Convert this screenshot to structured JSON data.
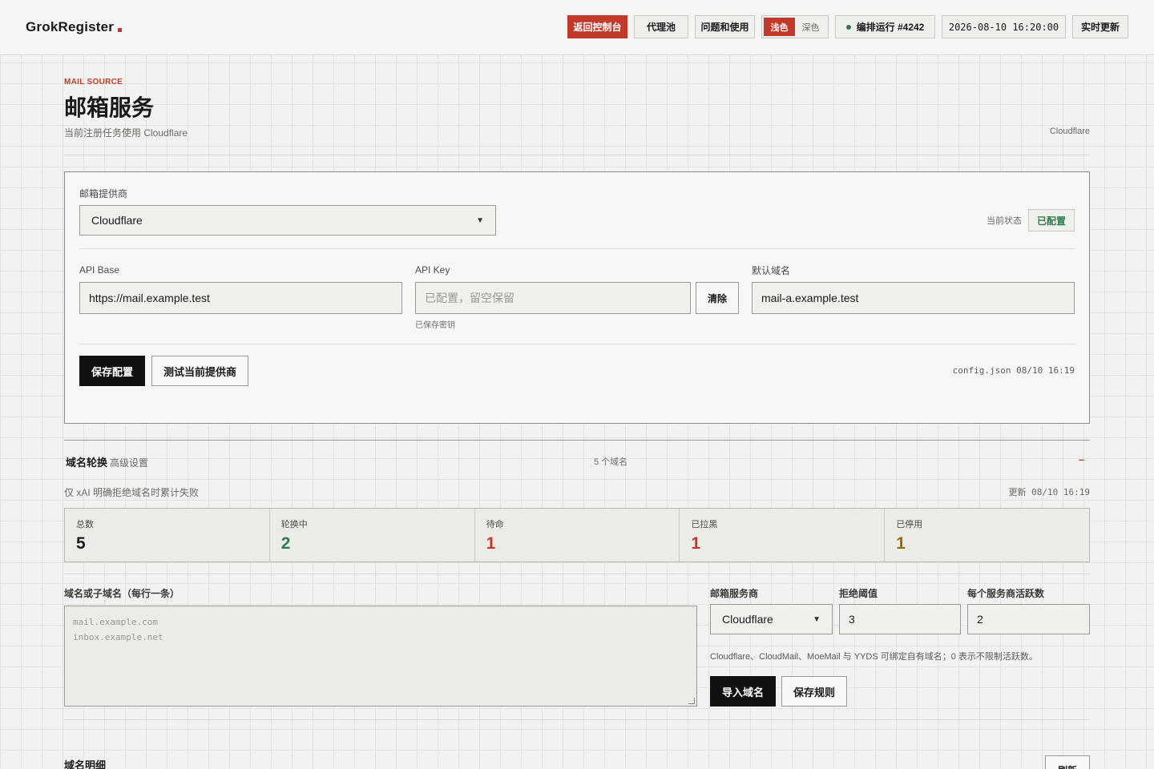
{
  "topbar": {
    "brand": "GrokRegister",
    "buttons": {
      "back_console": "返回控制台",
      "proxy_pool": "代理池",
      "faq_usage": "问题和使用",
      "realtime_refresh": "实时更新"
    },
    "theme": {
      "light": "浅色",
      "dark": "深色",
      "active": "light"
    },
    "run_status": "编排运行 #4242",
    "datetime": "2026-08-10 16:20:00"
  },
  "header": {
    "eyebrow": "MAIL SOURCE",
    "title": "邮箱服务",
    "subtitle": "当前注册任务使用 Cloudflare",
    "right_label": "Cloudflare"
  },
  "provider_card": {
    "provider_label": "邮箱提供商",
    "provider_value": "Cloudflare",
    "status_label": "当前状态",
    "status_value": "已配置",
    "api_base_label": "API Base",
    "api_base_value": "https://mail.example.test",
    "api_key_label": "API Key",
    "api_key_placeholder": "已配置，留空保留",
    "api_key_hint": "已保存密钥",
    "clear_button": "清除",
    "default_domain_label": "默认域名",
    "default_domain_value": "mail-a.example.test",
    "save_button": "保存配置",
    "test_button": "测试当前提供商",
    "config_meta": "config.json 08/10 16:19"
  },
  "rotation": {
    "title": "域名轮换",
    "subtitle": "高级设置",
    "domain_count": "5  个域名",
    "collapse_glyph": "–",
    "description": "仅 xAI 明确拒绝域名时累计失败",
    "updated": "更新 08/10 16:19",
    "stats": [
      {
        "label": "总数",
        "value": "5",
        "color": "#1a1a1a"
      },
      {
        "label": "轮换中",
        "value": "2",
        "color": "#2e7d4f"
      },
      {
        "label": "待命",
        "value": "1",
        "color": "#c0392b"
      },
      {
        "label": "已拉黑",
        "value": "1",
        "color": "#c0392b"
      },
      {
        "label": "已停用",
        "value": "1",
        "color": "#9a6a00"
      }
    ],
    "domains_label": "域名或子域名（每行一条）",
    "domains_placeholder_1": "mail.example.com",
    "domains_placeholder_2": "inbox.example.net",
    "mail_provider_label": "邮箱服务商",
    "mail_provider_value": "Cloudflare",
    "reject_threshold_label": "拒绝阈值",
    "reject_threshold_value": "3",
    "active_per_provider_label": "每个服务商活跃数",
    "active_per_provider_value": "2",
    "note": "Cloudflare、CloudMail、MoeMail 与 YYDS 可绑定自有域名；0 表示不限制活跃数。",
    "import_button": "导入域名",
    "save_rules_button": "保存规则"
  },
  "details": {
    "title": "域名明细",
    "refresh_button": "刷新"
  },
  "colors": {
    "accent": "#c0392b",
    "ok": "#2e7d4f",
    "dark": "#111111"
  }
}
